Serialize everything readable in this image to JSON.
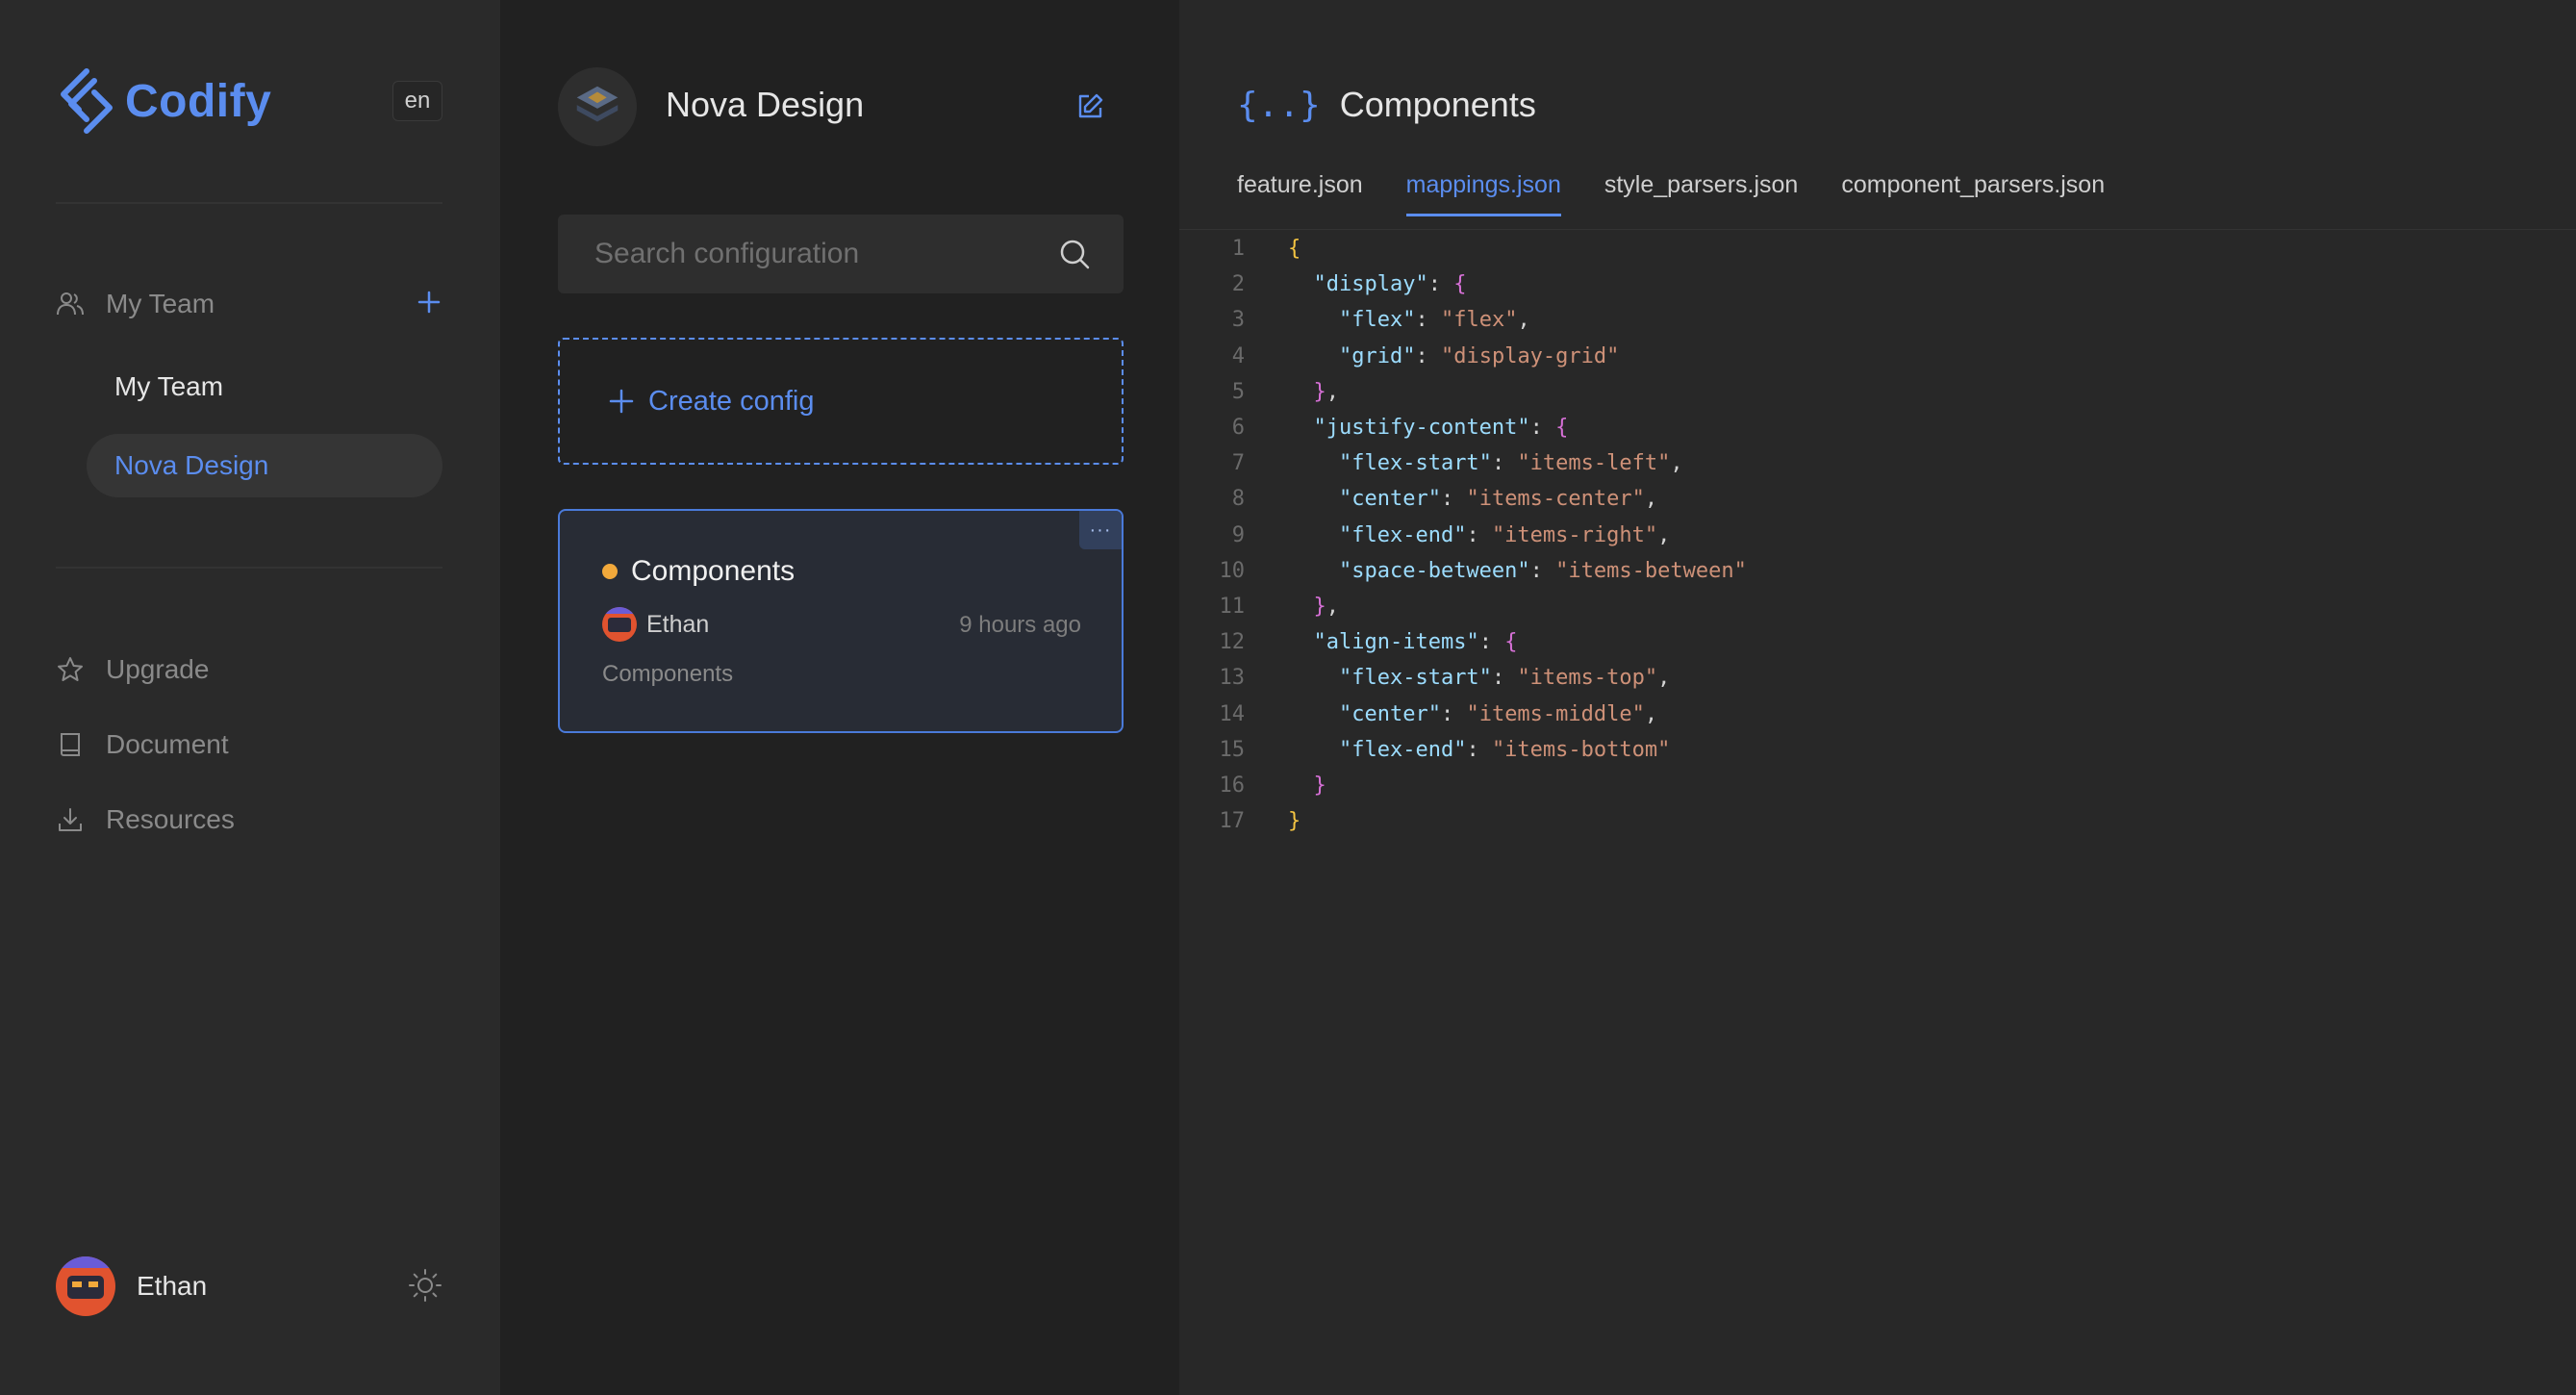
{
  "sidebar": {
    "brand": "Codify",
    "language": "en",
    "team_header": "My Team",
    "teams": [
      {
        "label": "My Team",
        "active": false
      },
      {
        "label": "Nova Design",
        "active": true
      }
    ],
    "links": [
      {
        "label": "Upgrade",
        "icon": "star-icon"
      },
      {
        "label": "Document",
        "icon": "book-icon"
      },
      {
        "label": "Resources",
        "icon": "download-icon"
      }
    ],
    "user": {
      "name": "Ethan"
    }
  },
  "project": {
    "title": "Nova Design",
    "search_placeholder": "Search configuration",
    "create_label": "Create config",
    "config_card": {
      "title": "Components",
      "status_color": "#f2a93b",
      "author": "Ethan",
      "time": "9 hours ago",
      "description": "Components",
      "menu": "···"
    }
  },
  "editor": {
    "braces": "{..}",
    "title": "Components",
    "tabs": [
      {
        "label": "feature.json",
        "active": false
      },
      {
        "label": "mappings.json",
        "active": true
      },
      {
        "label": "style_parsers.json",
        "active": false
      },
      {
        "label": "component_parsers.json",
        "active": false
      }
    ],
    "lines": [
      "{",
      "  \"display\": {",
      "    \"flex\": \"flex\",",
      "    \"grid\": \"display-grid\"",
      "  },",
      "  \"justify-content\": {",
      "    \"flex-start\": \"items-left\",",
      "    \"center\": \"items-center\",",
      "    \"flex-end\": \"items-right\",",
      "    \"space-between\": \"items-between\"",
      "  },",
      "  \"align-items\": {",
      "    \"flex-start\": \"items-top\",",
      "    \"center\": \"items-middle\",",
      "    \"flex-end\": \"items-bottom\"",
      "  }",
      "}"
    ]
  },
  "colors": {
    "accent": "#5b8def",
    "status_dot": "#f2a93b",
    "json_key": "#9cdcfe",
    "json_string": "#ce9178",
    "brace_outer": "#f5c542",
    "brace_inner": "#d670d6"
  }
}
